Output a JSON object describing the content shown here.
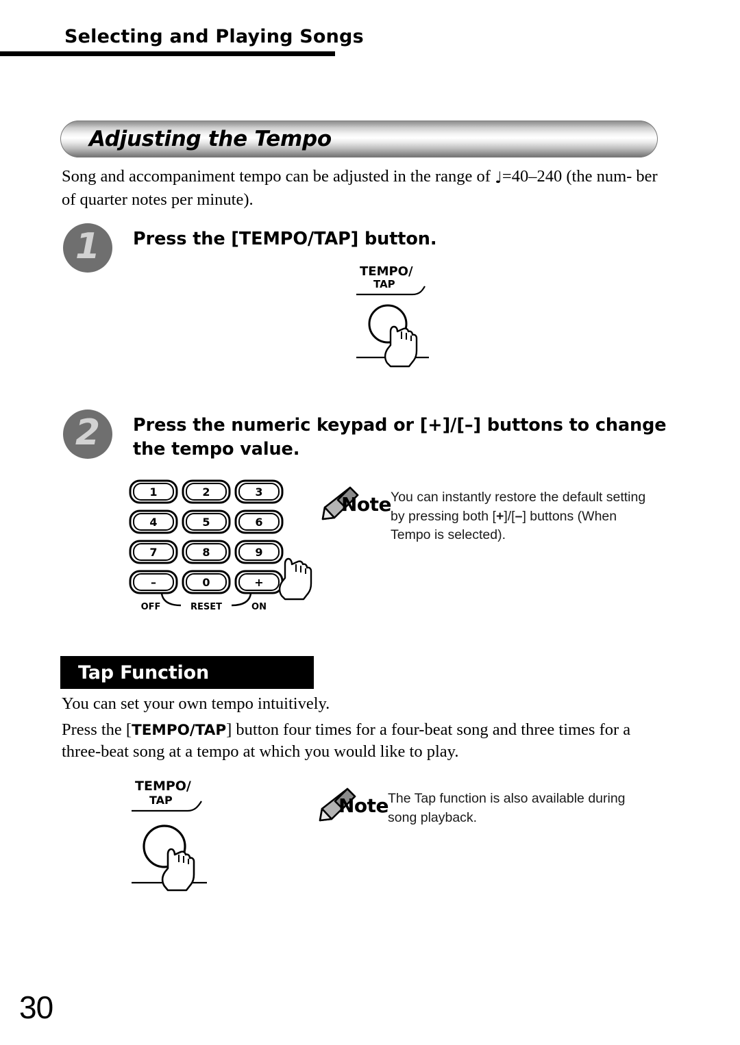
{
  "header": {
    "chapter_title": "Selecting and Playing Songs"
  },
  "section": {
    "banner_title": "Adjusting the Tempo",
    "intro_line1_before_glyph": "Song and accompaniment tempo can be adjusted in the range of ",
    "intro_glyph": "♩",
    "intro_line1_after_glyph": "=40–240 (the num-",
    "intro_line2": "ber of quarter notes per minute)."
  },
  "steps": [
    {
      "number": "1",
      "heading": "Press the [TEMPO/TAP] button."
    },
    {
      "number": "2",
      "heading": "Press the numeric keypad or [+]/[–] buttons to change the tempo value."
    }
  ],
  "tempo_button_illustration": {
    "label_line1": "TEMPO/",
    "label_line2": "TAP"
  },
  "keypad": {
    "keys": [
      "1",
      "2",
      "3",
      "4",
      "5",
      "6",
      "7",
      "8",
      "9",
      "–",
      "0",
      "+"
    ],
    "bottom_labels": {
      "minus": "OFF",
      "middle": "RESET",
      "plus": "ON"
    }
  },
  "notes": [
    {
      "word": "Note",
      "line1": "You can instantly restore the default setting by",
      "line2_a": "pressing both [",
      "line2_plus": "+",
      "line2_b": "]/[",
      "line2_minus": "–",
      "line2_c": "] buttons (When Tempo is",
      "line3": "selected)."
    },
    {
      "word": "Note",
      "line1": "The Tap function is also available during song",
      "line2": "playback."
    }
  ],
  "tap_function": {
    "bar_title": "Tap Function",
    "paragraph_1": "You can set your own tempo intuitively.",
    "paragraph_2_a": "Press the [",
    "paragraph_2_strong": "TEMPO/TAP",
    "paragraph_2_b": "] button four times for a four-beat song and three times for a",
    "paragraph_2_line2": "three-beat song at a tempo at which you would like to play."
  },
  "footer": {
    "page_number": "30"
  },
  "colors": {
    "badge_circle": "#6f6f6f",
    "badge_numeral": "#d2d2d2",
    "bar_background": "#000000",
    "bar_text": "#ffffff"
  }
}
